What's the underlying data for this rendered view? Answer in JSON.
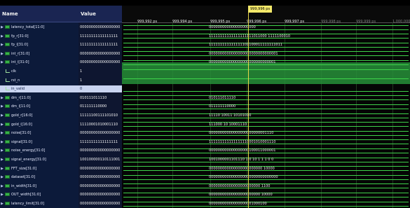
{
  "name_header": "Name",
  "value_header": "Value",
  "cursor_time": "999,996 ps",
  "time_ticks": [
    "999,992 ps",
    "999,994 ps",
    "999,995 ps",
    "999,996 ps",
    "999,997 ps",
    "999,998 ps",
    "999,999 ps",
    "1,000,000 ps"
  ],
  "signals": [
    {
      "name": "latency_total[11:0]",
      "value": "000000000000000000",
      "kind": "bus",
      "wave": "000000000000000000000"
    },
    {
      "name": "fp_r[31:0]",
      "value": "11111111111111111",
      "kind": "bus",
      "wave": "11111111111111111111011000 1111100010"
    },
    {
      "name": "fp_i[31:0]",
      "value": "11111111111111111",
      "kind": "bus",
      "wave": "111111111111111101100011111111011"
    },
    {
      "name": "int_r[31:0]",
      "value": "000000000000000000",
      "kind": "bus",
      "wave": "0000000000000000000000000000001"
    },
    {
      "name": "int_i[31:0]",
      "value": "000000000000000000",
      "kind": "bus",
      "wave": "000000000000000000000000000001"
    },
    {
      "name": "clk",
      "value": "1",
      "kind": "bit",
      "wave": ""
    },
    {
      "name": "rst_n",
      "value": "1",
      "kind": "bit",
      "wave": ""
    },
    {
      "name": "in_valid",
      "value": "0",
      "kind": "bit",
      "wave": ""
    },
    {
      "name": "dm_r[11:0]",
      "value": "010111011110",
      "kind": "bus",
      "wave": "010111011110"
    },
    {
      "name": "dm_i[11:0]",
      "value": "011111110000",
      "kind": "bus",
      "wave": "011111110000"
    },
    {
      "name": "gold_r[16:0]",
      "value": "11111100111101010",
      "kind": "bus",
      "wave": "11110 10011 10101010"
    },
    {
      "name": "gold_i[16:0]",
      "value": "11110001010001110",
      "kind": "bus",
      "wave": "111000 10 10001110"
    },
    {
      "name": "noise[31:0]",
      "value": "000000000000000000",
      "kind": "bus",
      "wave": "00000000000000000000000001110"
    },
    {
      "name": "signal[31:0]",
      "value": "11111111111111111",
      "kind": "bus",
      "wave": "111111111111111110001010001110"
    },
    {
      "name": "noise_energy[31:0]",
      "value": "000000000000000000",
      "kind": "bus",
      "wave": "000000000000000000100011000001"
    },
    {
      "name": "signal_energy[31:0]",
      "value": "100100000110111001",
      "kind": "bus",
      "wave": "1001000001101110 1 0 10 1 1 1 0 0"
    },
    {
      "name": "FFT_size[31:0]",
      "value": "000000000000000000",
      "kind": "bus",
      "wave": "000000000000000000000000 10000"
    },
    {
      "name": "dataset[31:0]",
      "value": "000000000000000000",
      "kind": "bus",
      "wave": "0000000000000000000000000000000"
    },
    {
      "name": "in_width[31:0]",
      "value": "000000000000000000",
      "kind": "bus",
      "wave": "00000000000000000000000 1100"
    },
    {
      "name": "OUT_width[31:0]",
      "value": "000000000000000000",
      "kind": "bus",
      "wave": "00000000000000000000000 10000"
    },
    {
      "name": "latency_limit[31:0]",
      "value": "000000000000000000",
      "kind": "bus",
      "wave": "00000000000000000001000100"
    }
  ]
}
